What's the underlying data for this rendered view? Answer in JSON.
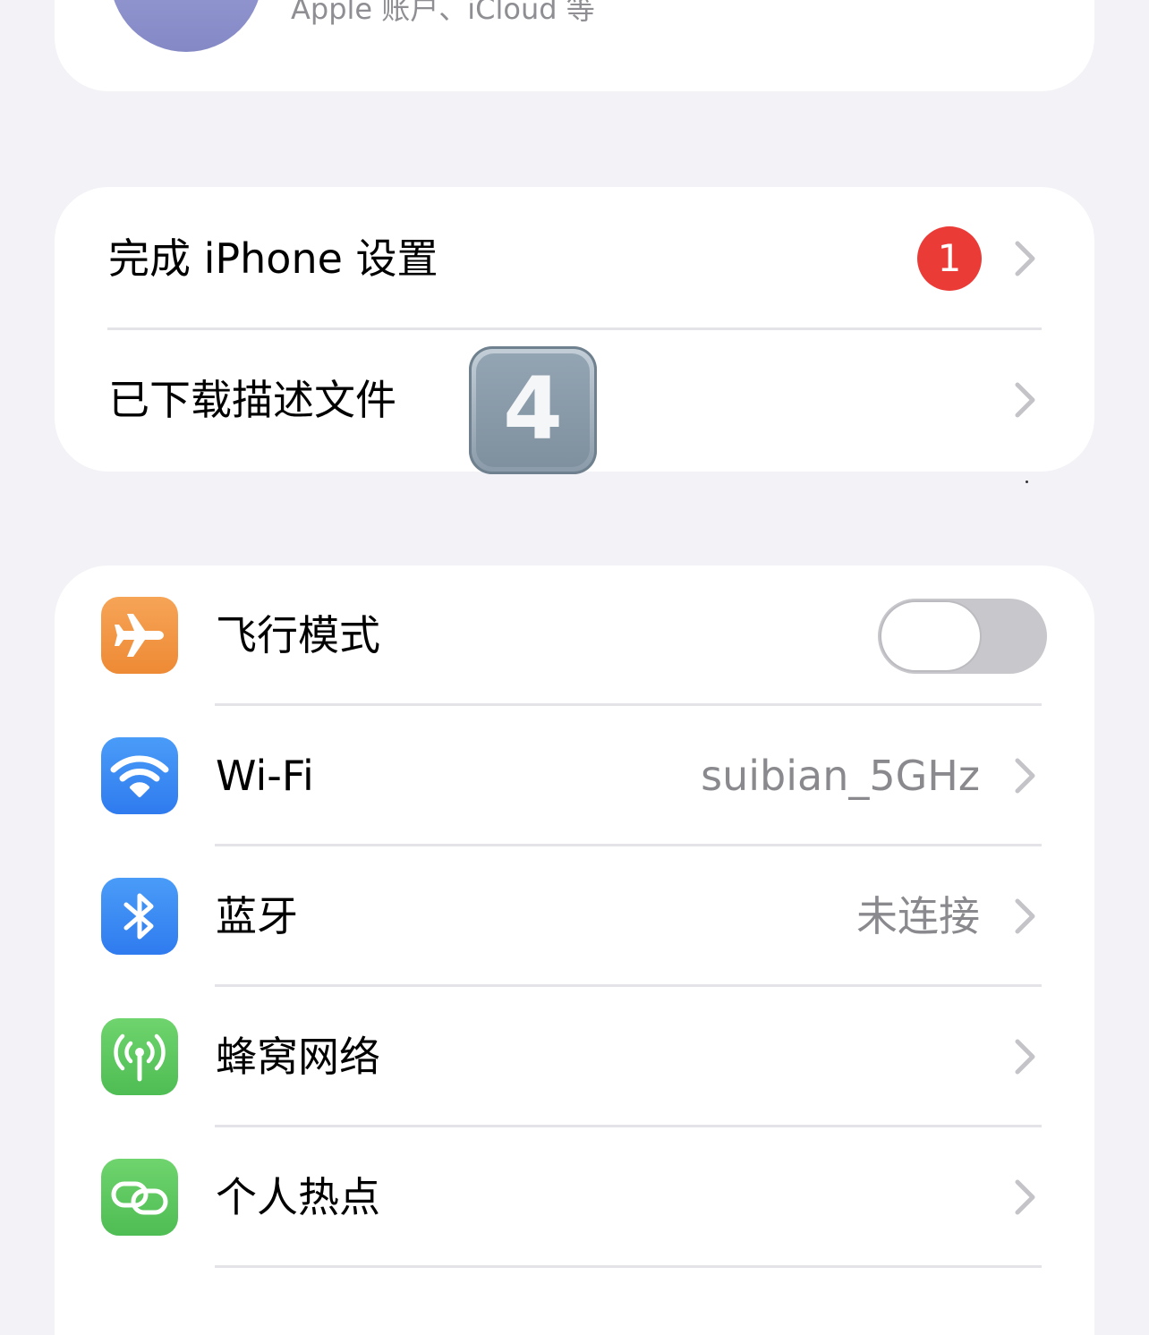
{
  "account": {
    "subtitle": "Apple 账户、iCloud 等"
  },
  "setup": {
    "finish": {
      "label": "完成 iPhone 设置",
      "badge": "1"
    },
    "profiles": {
      "label": "已下载描述文件",
      "overlay_digit": "4"
    }
  },
  "network": {
    "airplane": {
      "label": "飞行模式",
      "icon": "airplane-icon",
      "enabled": false
    },
    "wifi": {
      "label": "Wi-Fi",
      "value": "suibian_5GHz",
      "icon": "wifi-icon"
    },
    "bluetooth": {
      "label": "蓝牙",
      "value": "未连接",
      "icon": "bluetooth-icon"
    },
    "cellular": {
      "label": "蜂窝网络",
      "icon": "antenna-icon"
    },
    "hotspot": {
      "label": "个人热点",
      "icon": "link-icon"
    }
  },
  "colors": {
    "background": "#f2f2f7",
    "badge": "#eb3b37",
    "airplane_icon": "#f09444",
    "wifi_icon": "#3b8cf4",
    "bluetooth_icon": "#3b8cf4",
    "cellular_icon": "#5cc65e",
    "hotspot_icon": "#5cc65e",
    "toggle_off": "#c7c7cc",
    "secondary_text": "#8a8a8e"
  }
}
